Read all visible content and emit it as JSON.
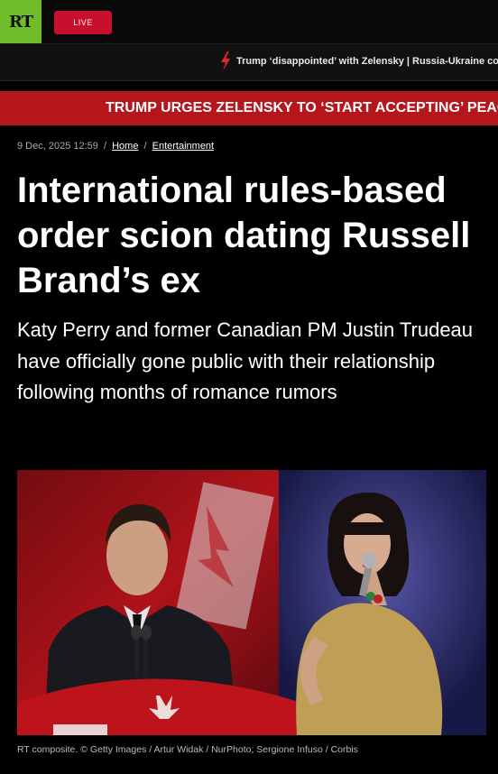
{
  "header": {
    "logo_text": "RT",
    "live_label": "LIVE",
    "logo_color": "#6fbd2b",
    "live_color": "#c8102e"
  },
  "ticker": {
    "text": "Trump ‘disappointed’ with Zelensky | Russia-Ukraine conflict",
    "icon": "lightning-bolt-icon"
  },
  "breaking": {
    "text": "TRUMP URGES ZELENSKY TO ‘START ACCEPTING’ PEACE PLAN",
    "color": "#b5161b"
  },
  "article": {
    "date": "9 Dec, 2025 12:59",
    "breadcrumb": [
      "Home",
      "Entertainment"
    ],
    "title": "International rules-based order scion dating Russell Brand’s ex",
    "lede": "Katy Perry and former Canadian PM Justin Trudeau have officially gone public with their relationship following months of romance rumors",
    "image_caption": "RT composite. © Getty Images / Artur Widak / NurPhoto; Sergione Infuso / Corbis"
  }
}
